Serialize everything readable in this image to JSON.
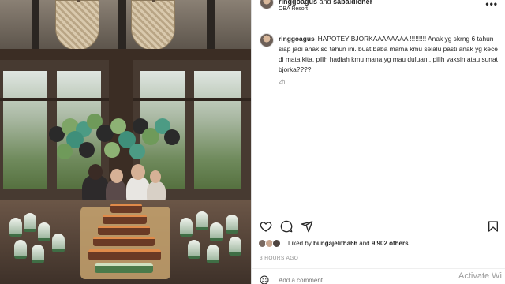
{
  "post": {
    "header": {
      "username": "ringgoagus",
      "connector": "and",
      "coauthor": "sabaidiener",
      "location": "OBA Resort",
      "more_label": "•••"
    },
    "caption": {
      "username": "ringgoagus",
      "text": "HAPOTEY BJÖRKAAAAAAAA !!!!!!!!! Anak yg skrng 6 tahun siap jadi anak sd tahun ini. buat baba mama kmu selalu pasti anak yg kece di mata kita. pilih hadiah kmu mana yg mau duluan.. pilih vaksin atau sunat bjorka????",
      "time": "2h"
    },
    "likes": {
      "prefix": "Liked by",
      "liker": "bungajelitha66",
      "connector": "and",
      "others": "9,902 others"
    },
    "posted_ago": "3 HOURS AGO",
    "comment_placeholder": "Add a comment..."
  },
  "icons": {
    "like": "heart-icon",
    "comment": "speech-bubble-icon",
    "share": "paper-plane-icon",
    "save": "bookmark-icon",
    "more": "ellipsis-icon",
    "emoji": "smiley-icon"
  },
  "overlay": {
    "watermark": "Activate Wi"
  },
  "colors": {
    "text": "#262626",
    "muted": "#8e8e8e",
    "border": "#dbdbdb",
    "balloon_green": "#6f9a5a",
    "balloon_black": "#2a2a2a",
    "balloon_teal": "#3f8f7a"
  }
}
